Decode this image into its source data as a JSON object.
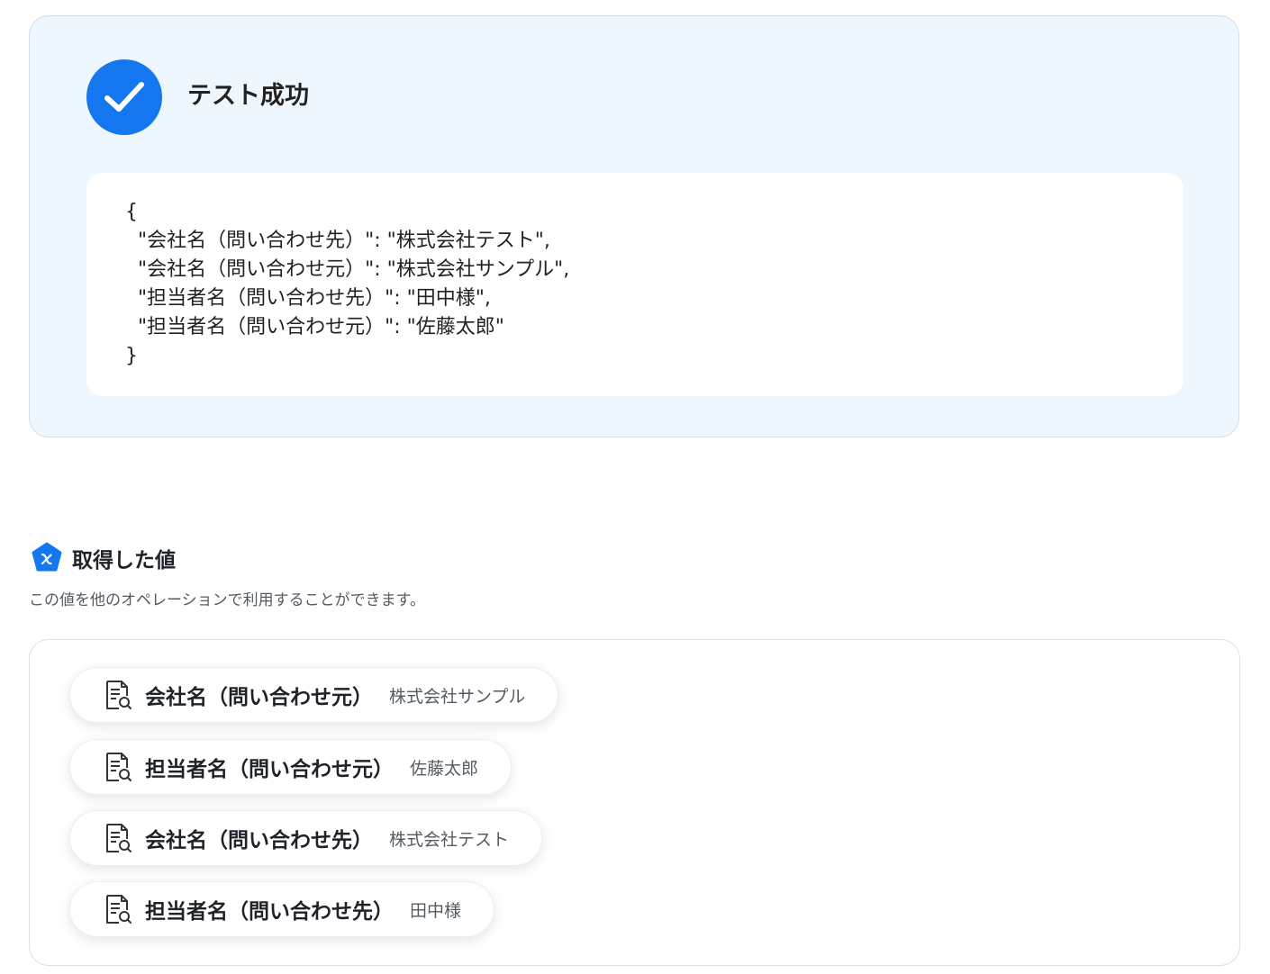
{
  "result": {
    "title": "テスト成功",
    "icon": "check-circle-icon",
    "accent_color": "#1477f0",
    "json_output": "{\n  \"会社名（問い合わせ先）\": \"株式会社テスト\",\n  \"会社名（問い合わせ元）\": \"株式会社サンプル\",\n  \"担当者名（問い合わせ先）\": \"田中様\",\n  \"担当者名（問い合わせ元）\": \"佐藤太郎\"\n}"
  },
  "values_section": {
    "title": "取得した値",
    "icon": "variable-icon",
    "description": "この値を他のオペレーションで利用することができます。",
    "items": [
      {
        "key": "会社名（問い合わせ元）",
        "value": "株式会社サンプル",
        "icon": "document-search-icon"
      },
      {
        "key": "担当者名（問い合わせ元）",
        "value": "佐藤太郎",
        "icon": "document-search-icon"
      },
      {
        "key": "会社名（問い合わせ先）",
        "value": "株式会社テスト",
        "icon": "document-search-icon"
      },
      {
        "key": "担当者名（問い合わせ先）",
        "value": "田中様",
        "icon": "document-search-icon"
      }
    ]
  }
}
